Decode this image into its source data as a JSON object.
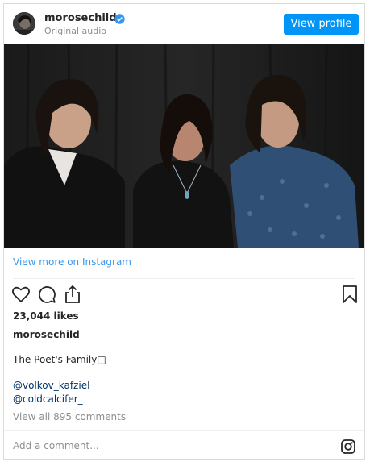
{
  "header": {
    "username": "morosechild",
    "subtitle": "Original audio",
    "view_profile_label": "View profile"
  },
  "media": {
    "alt": "Photo of three people in front of a dark curtain"
  },
  "view_more_label": "View more on Instagram",
  "actions": {
    "like_icon": "heart-icon",
    "comment_icon": "comment-icon",
    "share_icon": "share-icon",
    "save_icon": "bookmark-icon"
  },
  "likes": "23,044 likes",
  "caption": {
    "username": "morosechild",
    "text": "The Poet's Family□",
    "mentions": [
      "@volkov_kafziel",
      "@coldcalcifer_"
    ]
  },
  "comments_label": "View all 895 comments",
  "comment_input": {
    "placeholder": "Add a comment..."
  },
  "colors": {
    "accent": "#0095f6",
    "link": "#3897f0",
    "mention": "#003569",
    "muted": "#8e8e8e",
    "border": "#dbdbdb"
  }
}
